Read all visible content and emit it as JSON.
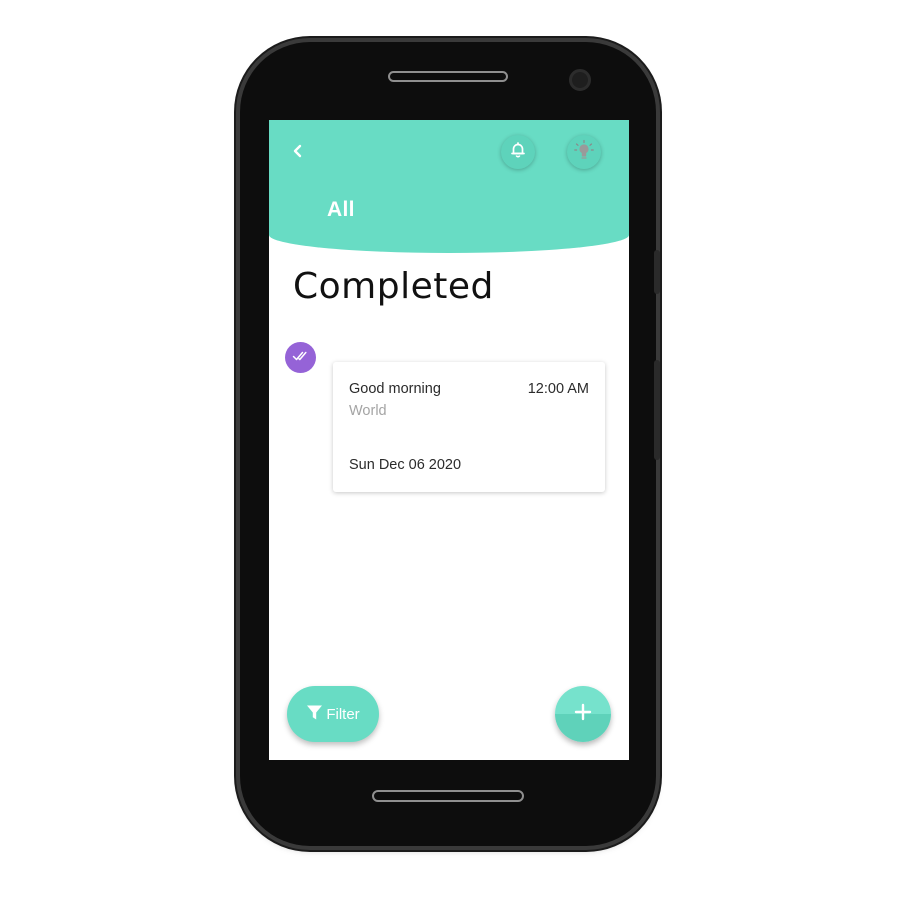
{
  "colors": {
    "header_bg": "#68dcc4",
    "accent_purple": "#9563d7",
    "subtext_gray": "#a4a4a4",
    "text_dark": "#2b2b2b"
  },
  "header": {
    "back_icon": "chevron-left-icon",
    "notification_icon": "bell-icon",
    "theme_icon": "lightbulb-icon",
    "title": "All"
  },
  "main": {
    "page_title": "Completed",
    "tasks": [
      {
        "status_icon": "double-check-icon",
        "title": "Good morning",
        "subtitle": "World",
        "time": "12:00 AM",
        "date": "Sun Dec 06 2020"
      }
    ]
  },
  "footer": {
    "filter_label": "Filter",
    "filter_icon": "funnel-icon",
    "add_icon": "plus-icon"
  }
}
